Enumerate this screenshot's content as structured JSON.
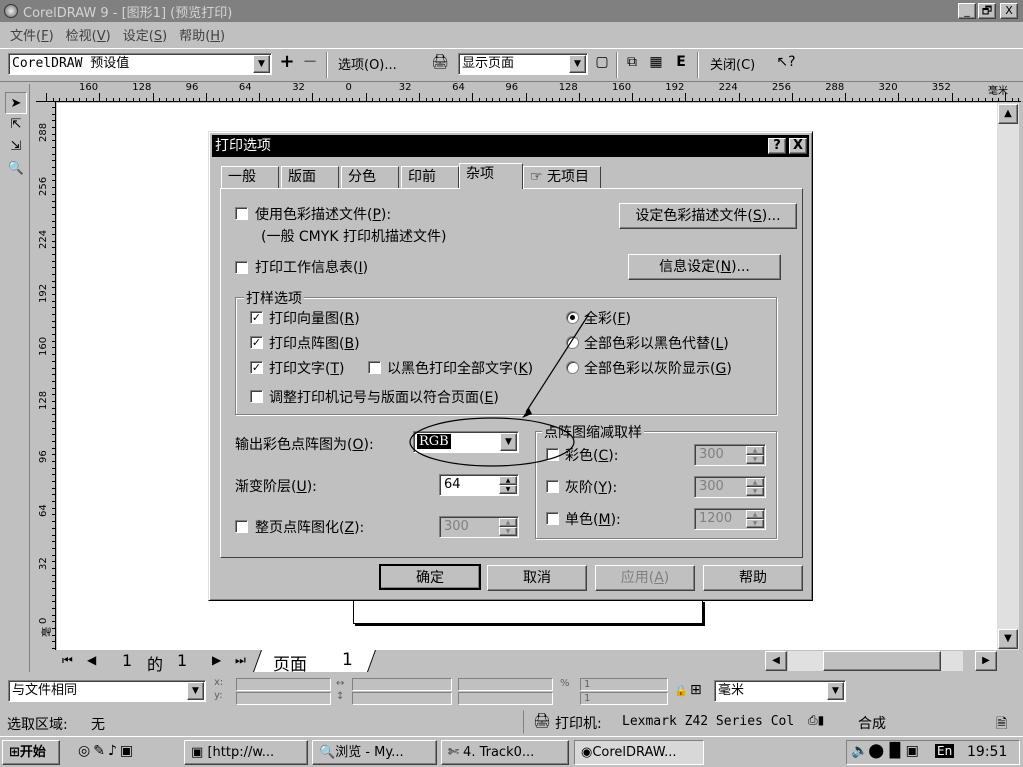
{
  "window": {
    "title": "CorelDRAW 9 - [图形1] (预览打印)",
    "minimize": "_",
    "restore": "🗗",
    "close": "X"
  },
  "menu": [
    {
      "label": "文件",
      "key": "F"
    },
    {
      "label": "检视",
      "key": "V"
    },
    {
      "label": "设定",
      "key": "S"
    },
    {
      "label": "帮助",
      "key": "H"
    }
  ],
  "toolbar": {
    "preset": "CorelDRAW 预设值",
    "plus": "+",
    "minus": "−",
    "options": "选项(O)...",
    "view_mode": "显示页面",
    "e_label": "E",
    "close": "关闭(C)"
  },
  "ruler_top": [
    "160",
    "128",
    "96",
    "64",
    "32",
    "0",
    "32",
    "64",
    "96",
    "128",
    "160",
    "192",
    "224",
    "256",
    "288",
    "320",
    "352",
    "毫米"
  ],
  "ruler_left": [
    "288",
    "256",
    "224",
    "192",
    "160",
    "128",
    "96",
    "64",
    "32",
    "0",
    "毫米"
  ],
  "page_nav": {
    "current": "1",
    "of": "的",
    "total": "1",
    "page_tab": "页面",
    "page_num": "1"
  },
  "propbar": {
    "scope": "与文件相同",
    "x_label": "x:",
    "y_label": "y:",
    "field_one": "1",
    "field_two": "1",
    "units": "毫米"
  },
  "status": {
    "selection_label": "选取区域:",
    "selection_value": "无",
    "printer_label": "打印机:",
    "printer_value": "Lexmark Z42 Series Col",
    "mode": "合成"
  },
  "taskbar": {
    "start": "开始",
    "tasks": [
      "[http://w...",
      "浏览 - My...",
      "4. Track0...",
      "CorelDRAW..."
    ],
    "lang": "En",
    "clock": "19:51"
  },
  "dialog": {
    "title": "打印选项",
    "help_btn": "?",
    "close_btn": "X",
    "tabs": [
      "一般",
      "版面",
      "分色",
      "印前",
      "杂项",
      "无项目"
    ],
    "active_tab": "杂项",
    "use_color_profile": {
      "label": "使用色彩描述文件",
      "key": "P",
      "checked": false
    },
    "profile_name": "(一般 CMYK 打印机描述文件)",
    "set_profile_btn": {
      "label": "设定色彩描述文件",
      "key": "S",
      "suffix": "..."
    },
    "print_job_info": {
      "label": "打印工作信息表",
      "key": "I",
      "checked": false
    },
    "info_settings_btn": {
      "label": "信息设定",
      "key": "N",
      "suffix": "..."
    },
    "proof_group": "打样选项",
    "print_vectors": {
      "label": "打印向量图",
      "key": "R",
      "checked": true
    },
    "print_bitmaps": {
      "label": "打印点阵图",
      "key": "B",
      "checked": true
    },
    "print_text": {
      "label": "打印文字",
      "key": "T",
      "checked": true
    },
    "print_text_black": {
      "label": "以黑色打印全部文字",
      "key": "K",
      "checked": false
    },
    "fit_marks": {
      "label": "调整打印机记号与版面以符合页面",
      "key": "E",
      "checked": false
    },
    "color_full": {
      "label": "全彩",
      "key": "F",
      "selected": true
    },
    "color_black": {
      "label": "全部色彩以黑色代替",
      "key": "L",
      "selected": false
    },
    "color_gray": {
      "label": "全部色彩以灰阶显示",
      "key": "G",
      "selected": false
    },
    "output_bitmap": {
      "label": "输出彩色点阵图为",
      "key": "O",
      "value": "RGB"
    },
    "fountain_steps": {
      "label": "渐变阶层",
      "key": "U",
      "value": "64"
    },
    "rasterize_page": {
      "label": "整页点阵图化",
      "key": "Z",
      "value": "300",
      "checked": false
    },
    "downsample_group": "点阵图缩减取样",
    "ds_color": {
      "label": "彩色",
      "key": "C",
      "value": "300",
      "checked": false
    },
    "ds_gray": {
      "label": "灰阶",
      "key": "Y",
      "value": "300",
      "checked": false
    },
    "ds_mono": {
      "label": "单色",
      "key": "M",
      "value": "1200",
      "checked": false
    },
    "ok": "确定",
    "cancel": "取消",
    "apply": {
      "label": "应用",
      "key": "A"
    },
    "help": "帮助"
  }
}
